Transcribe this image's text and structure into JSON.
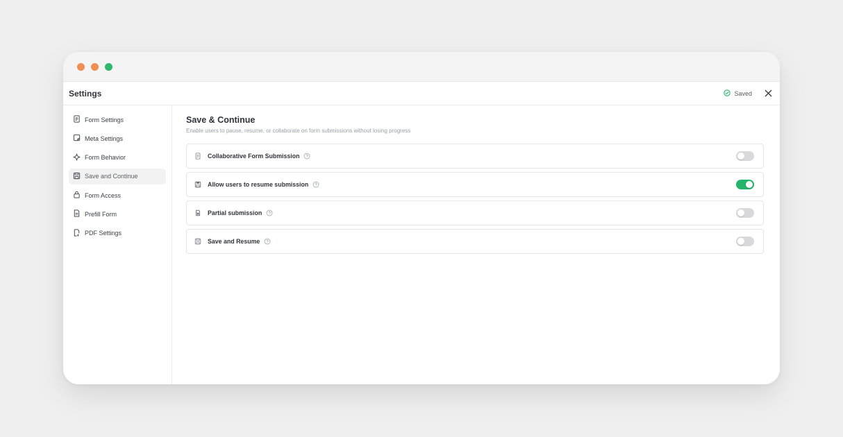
{
  "window": {
    "controls": [
      {
        "name": "close-dot",
        "color": "#ee8f55"
      },
      {
        "name": "minimize-dot",
        "color": "#ee8f55"
      },
      {
        "name": "maximize-dot",
        "color": "#2fb86b"
      }
    ]
  },
  "header": {
    "title": "Settings",
    "status": "Saved",
    "status_icon": "check-circle-icon",
    "close_icon": "close-icon"
  },
  "sidebar": {
    "items": [
      {
        "label": "Form Settings",
        "icon": "form-settings-icon",
        "active": false
      },
      {
        "label": "Meta Settings",
        "icon": "meta-settings-icon",
        "active": false
      },
      {
        "label": "Form Behavior",
        "icon": "sparkle-icon",
        "active": false
      },
      {
        "label": "Save and Continue",
        "icon": "save-icon",
        "active": true
      },
      {
        "label": "Form Access",
        "icon": "lock-icon",
        "active": false
      },
      {
        "label": "Prefill Form",
        "icon": "document-icon",
        "active": false
      },
      {
        "label": "PDF Settings",
        "icon": "pdf-icon",
        "active": false
      }
    ]
  },
  "main": {
    "title": "Save & Continue",
    "description": "Enable users to pause, resume, or collaborate on form submissions without losing progress",
    "options": [
      {
        "label": "Collaborative Form Submission",
        "icon": "document-icon",
        "enabled": false
      },
      {
        "label": "Allow users to resume submission",
        "icon": "save-icon",
        "enabled": true
      },
      {
        "label": "Partial submission",
        "icon": "clipboard-icon",
        "enabled": false
      },
      {
        "label": "Save and Resume",
        "icon": "save-icon",
        "enabled": false
      }
    ]
  },
  "colors": {
    "accent": "#24b56a",
    "toggle_off": "#d9d9dc",
    "background": "#efefef"
  }
}
